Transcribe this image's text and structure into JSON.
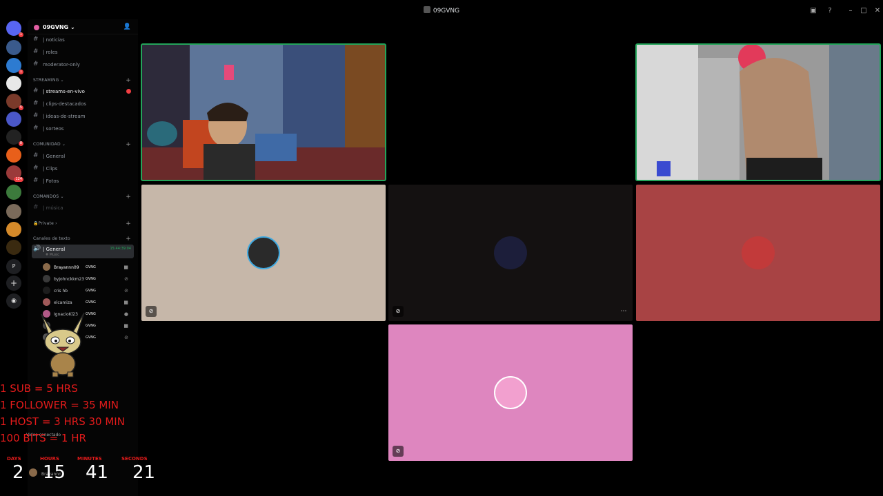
{
  "window": {
    "title": "09GVNG"
  },
  "server": {
    "name": "09GVNG"
  },
  "rail": {
    "badges": [
      "1",
      "1",
      "5",
      "8",
      "124"
    ]
  },
  "channels": {
    "top": [
      {
        "label": "| noticias"
      },
      {
        "label": "| roles"
      },
      {
        "label": "moderator-only"
      }
    ],
    "categories": {
      "streaming": "STREAMING",
      "comunidad": "COMUNIDAD",
      "comandos": "COMANDOS",
      "private": "Private",
      "texto": "Canales de texto"
    },
    "streaming": [
      {
        "label": "| streams-en-vivo"
      },
      {
        "label": "| clips-destacados"
      },
      {
        "label": "| ideas-de-stream"
      },
      {
        "label": "| sorteos"
      }
    ],
    "comunidad": [
      {
        "label": "| General"
      },
      {
        "label": "| Clips"
      },
      {
        "label": "| Fotos"
      }
    ],
    "comandos": [
      {
        "label": "| música"
      }
    ],
    "voice": {
      "label": "| General",
      "sublabel": "# Music",
      "time": "15:44:39:04"
    },
    "users": [
      {
        "name": "Brayannn09",
        "tag": "GVNG"
      },
      {
        "name": "byjohnckkm23",
        "tag": "GVNG"
      },
      {
        "name": "cris hb",
        "tag": "GVNG"
      },
      {
        "name": "elcamiza",
        "tag": "GVNG"
      },
      {
        "name": "IgnacioKl23",
        "tag": "GVNG"
      },
      {
        "name": "",
        "tag": "GVNG"
      },
      {
        "name": "909",
        "tag": "GVNG"
      }
    ]
  },
  "overlay": {
    "lines": [
      "1 SUB = 5 HRS",
      "1 FOLLOWER = 35 MIN",
      "1 HOST = 3 HRS 30 MIN",
      "100 BITS = 1 HR"
    ],
    "timer": {
      "labels": {
        "days": "DAYS",
        "hours": "HOURS",
        "minutes": "MINUTES",
        "seconds": "SECONDS"
      },
      "values": {
        "days": "2",
        "hours": "15",
        "minutes": "41",
        "seconds": "21"
      }
    }
  },
  "status": {
    "voice_connected": "Video conectado",
    "user": "Brayannn"
  },
  "colors": {
    "tile_beige": "#c6b7a9",
    "tile_dark": "#141111",
    "tile_red": "#a84344",
    "tile_pink": "#de86bf",
    "speaking": "#23a55a"
  }
}
